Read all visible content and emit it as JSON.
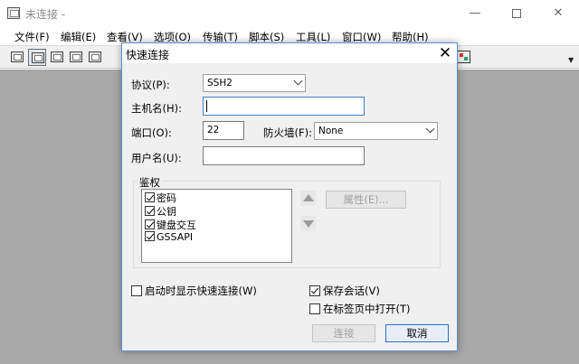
{
  "app": {
    "title": "未连接 -",
    "window_controls": {
      "minimize": "—",
      "close": "✕"
    }
  },
  "menubar": [
    {
      "label": "文件(F)"
    },
    {
      "label": "编辑(E)"
    },
    {
      "label": "查看(V)"
    },
    {
      "label": "选项(O)"
    },
    {
      "label": "传输(T)"
    },
    {
      "label": "脚本(S)"
    },
    {
      "label": "工具(L)"
    },
    {
      "label": "窗口(W)"
    },
    {
      "label": "帮助(H)"
    }
  ],
  "toolbar": {
    "icons": [
      "connect-icon",
      "quick-connect-icon",
      "connect-in-tab-icon",
      "reconnect-icon",
      "disconnect-icon"
    ],
    "overflow_arrow": "▼"
  },
  "dialog": {
    "title": "快速连接",
    "close": "✕",
    "protocol": {
      "label": "协议(P):",
      "value": "SSH2"
    },
    "hostname": {
      "label": "主机名(H):",
      "value": ""
    },
    "port": {
      "label": "端口(O):",
      "value": "22"
    },
    "firewall": {
      "label": "防火墙(F):",
      "value": "None"
    },
    "username": {
      "label": "用户名(U):",
      "value": ""
    },
    "auth": {
      "label": "鉴权",
      "methods": [
        {
          "label": "密码",
          "checked": true
        },
        {
          "label": "公钥",
          "checked": true
        },
        {
          "label": "键盘交互",
          "checked": true
        },
        {
          "label": "GSSAPI",
          "checked": true
        }
      ],
      "properties_button": "属性(E)..."
    },
    "show_on_startup": {
      "label": "启动时显示快速连接(W)",
      "checked": false
    },
    "save_session": {
      "label": "保存会话(V)",
      "checked": true
    },
    "open_in_tab": {
      "label": "在标签页中打开(T)",
      "checked": false
    },
    "connect_button": "连接",
    "cancel_button": "取消"
  }
}
